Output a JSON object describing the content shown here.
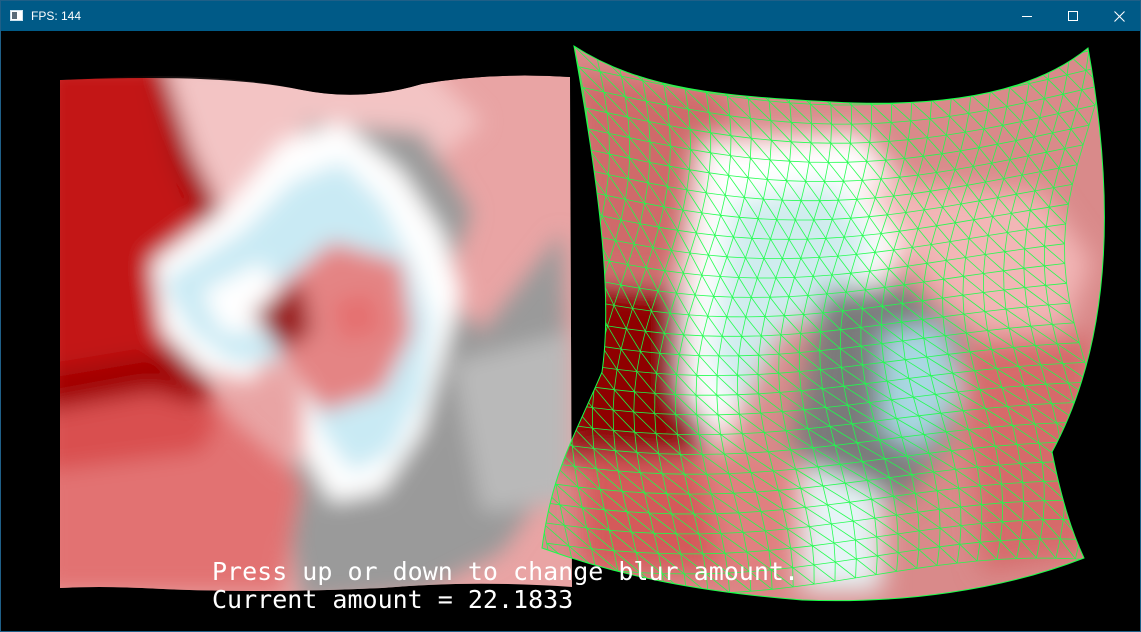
{
  "window": {
    "title": "FPS: 144",
    "controls": {
      "minimize": "minimize",
      "maximize": "maximize",
      "close": "close"
    },
    "colors": {
      "titlebar": "#005a87",
      "background": "#000000"
    }
  },
  "scene": {
    "left_panel": "blurred texture on warped quad",
    "right_panel": "blurred texture with green wireframe mesh",
    "wireframe_color": "#00ff44"
  },
  "overlay": {
    "instruction": "Press up or down to change blur amount.",
    "current_amount": "Current amount = 22.1833"
  }
}
